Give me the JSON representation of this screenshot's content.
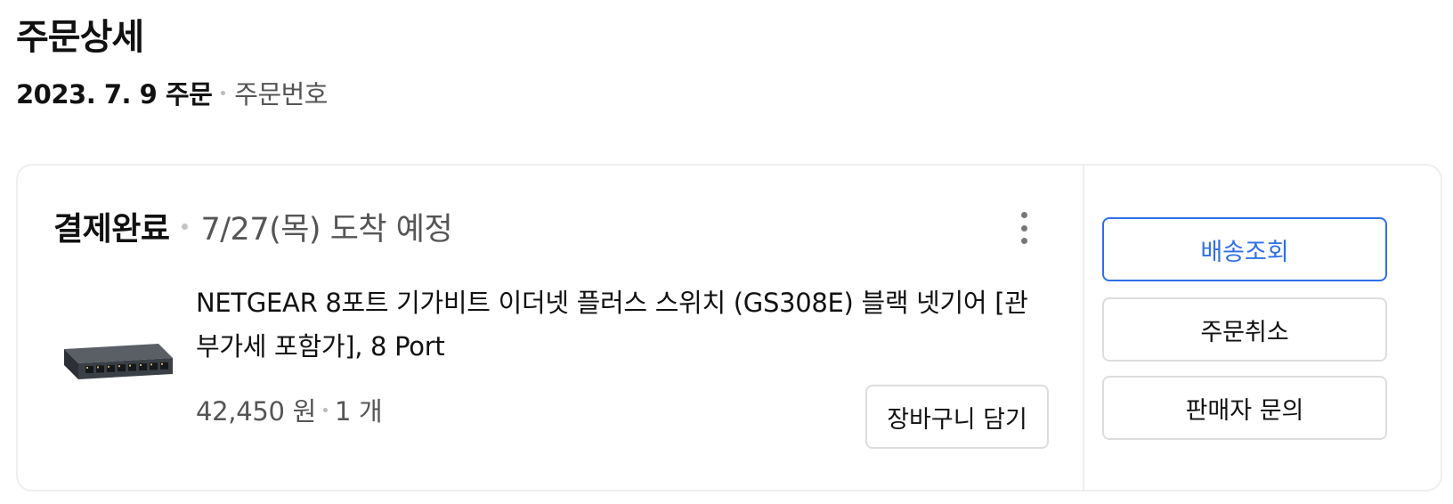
{
  "header": {
    "title": "주문상세",
    "order_date": "2023. 7. 9 주문",
    "order_number_label": "주문번호"
  },
  "order": {
    "status": "결제완료",
    "arrival": "7/27(목) 도착 예정",
    "product": {
      "name_line1": "NETGEAR 8포트 기가비트 이더넷 플러스 스위치 (GS308E) 블랙 넷기어 [관",
      "name_line2": "부가세 포함가], 8 Port",
      "price": "42,450 원",
      "quantity": "1 개",
      "image_icon": "network-switch-image"
    },
    "cart_button": "장바구니 담기",
    "more_icon": "more-vertical-icon"
  },
  "actions": {
    "track_delivery": "배송조회",
    "cancel_order": "주문취소",
    "contact_seller": "판매자 문의"
  },
  "colors": {
    "accent": "#2f6fe8",
    "border": "#dddddd",
    "muted_text": "#555555"
  }
}
